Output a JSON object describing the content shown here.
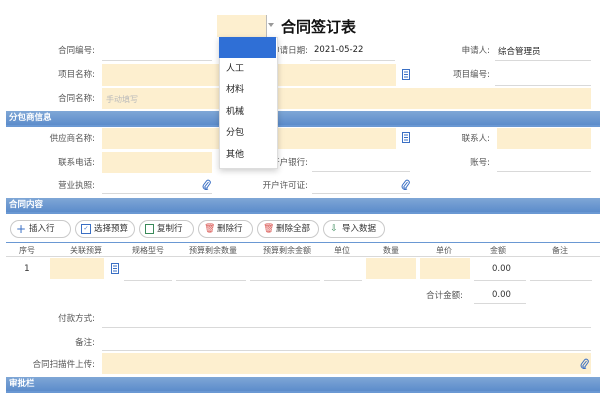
{
  "title": "合同签订表",
  "header": {
    "contract_no_label": "合同编号:",
    "apply_date_label": "申请日期:",
    "apply_date_value": "2021-05-22",
    "applicant_label": "申请人:",
    "applicant_value": "综合管理员",
    "project_name_label": "项目名称:",
    "project_no_label": "项目编号:",
    "contract_name_label": "合同名称:",
    "contract_name_placeholder": "手动填写"
  },
  "dropdown": {
    "options": [
      "",
      "人工",
      "材料",
      "机械",
      "分包",
      "其他"
    ]
  },
  "sections": {
    "subcontractor": "分包商信息",
    "contract_content": "合同内容",
    "approval": "审批栏"
  },
  "subcontractor": {
    "supplier_label": "供应商名称:",
    "contact_label": "联系人:",
    "phone_label": "联系电话:",
    "bank_label": "开户银行:",
    "account_label": "账号:",
    "license_label": "营业执照:",
    "permit_label": "开户许可证:"
  },
  "toolbar": {
    "insert": "插入行",
    "select_budget": "选择预算",
    "copy": "复制行",
    "delete": "删除行",
    "delete_all": "删除全部",
    "import": "导入数据"
  },
  "table": {
    "headers": [
      "序号",
      "关联预算",
      "规格型号",
      "预算剩余数量",
      "预算剩余金额",
      "单位",
      "数量",
      "单价",
      "金额",
      "备注"
    ],
    "rows": [
      {
        "index": "1",
        "amount": "0.00"
      }
    ],
    "total_label": "合计金额:",
    "total_value": "0.00"
  },
  "footer": {
    "payment_label": "付款方式:",
    "remark_label": "备注:",
    "attachment_label": "合同扫描件上传:"
  },
  "colors": {
    "field_bg": "#fdefcf",
    "section_bg": "#5c8ccb",
    "selected_option": "#2f6fd6"
  }
}
